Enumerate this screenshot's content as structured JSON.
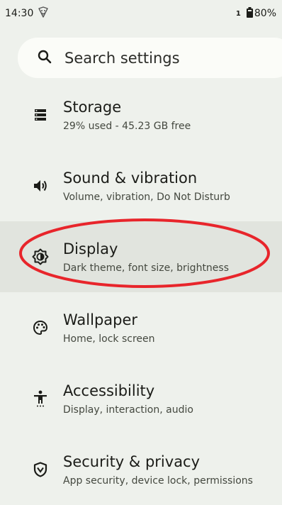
{
  "status_bar": {
    "time": "14:30",
    "sim": "1",
    "battery": "80%"
  },
  "search": {
    "placeholder": "Search settings",
    "icon": "search-icon"
  },
  "items": [
    {
      "title": "Storage",
      "subtitle": "29% used - 45.23 GB free",
      "icon": "storage-icon"
    },
    {
      "title": "Sound & vibration",
      "subtitle": "Volume, vibration, Do Not Disturb",
      "icon": "volume-icon"
    },
    {
      "title": "Display",
      "subtitle": "Dark theme, font size, brightness",
      "icon": "brightness-icon",
      "selected": true
    },
    {
      "title": "Wallpaper",
      "subtitle": "Home, lock screen",
      "icon": "palette-icon"
    },
    {
      "title": "Accessibility",
      "subtitle": "Display, interaction, audio",
      "icon": "accessibility-icon"
    },
    {
      "title": "Security & privacy",
      "subtitle": "App security, device lock, permissions",
      "icon": "shield-icon"
    }
  ],
  "annotation": {
    "color": "#e8252b"
  }
}
